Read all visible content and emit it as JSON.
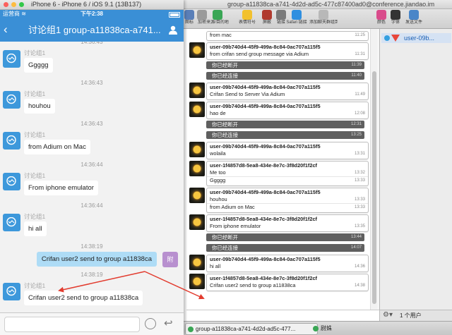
{
  "simulator": {
    "window_title": "iPhone 6 - iPhone 6 / iOS 9.1 (13B137)",
    "status": {
      "carrier": "运营商",
      "time": "下午2:38"
    },
    "nav_title": "讨论组1 group-a11838ca-a741...",
    "messages": [
      {
        "kind": "received",
        "time": "14:36:43",
        "sender": "讨论组1",
        "text": "Ggggg"
      },
      {
        "kind": "received",
        "time": "14:36:43",
        "sender": "讨论组1",
        "text": "houhou"
      },
      {
        "kind": "received",
        "time": "14:36:43",
        "sender": "讨论组1",
        "text": "from Adium on Mac"
      },
      {
        "kind": "received",
        "time": "14:36:44",
        "sender": "讨论组1",
        "text": "From iphone emulator"
      },
      {
        "kind": "received",
        "time": "14:36:44",
        "sender": "讨论组1",
        "text": "hi all"
      },
      {
        "kind": "sent",
        "time": "14:38:19",
        "text": "Crifan user2 send to group a11838ca",
        "avatar_label": "附"
      },
      {
        "kind": "received",
        "time": "14:38:19",
        "sender": "讨论组1",
        "text": "Crifan user2 send to group a11838ca"
      }
    ]
  },
  "adium": {
    "window_title": "group-a11838ca-a741-4d2d-ad5c-477c87400ad0@conference.jiandao.im",
    "toolbar": [
      {
        "label": "图标",
        "icon": "format-icon",
        "color": "#5a7fb8"
      },
      {
        "label": "加密",
        "icon": "lock-icon",
        "color": "#9a9a9a"
      },
      {
        "label": "来源/目的地",
        "icon": "source-icon",
        "color": "#3aa655"
      },
      {
        "label": "表情符号",
        "icon": "smiley-icon",
        "color": "#f2c12e"
      },
      {
        "label": "屏蔽",
        "icon": "block-icon",
        "color": "#b03a2e"
      },
      {
        "label": "链接",
        "icon": "link-icon",
        "color": "#7a7a7a"
      },
      {
        "label": "Safari 链接",
        "icon": "safari-icon",
        "color": "#2f8fe0"
      },
      {
        "label": "添加聊天群组到收藏",
        "icon": "bookmark-icon",
        "color": "#b8b8b8"
      },
      {
        "label": "颜色",
        "icon": "color-icon",
        "color": "#d94b8b"
      },
      {
        "label": "字体",
        "icon": "font-icon",
        "color": "#333333"
      },
      {
        "label": "发送文件",
        "icon": "send-file-icon",
        "color": "#4a86c8"
      }
    ],
    "messages": [
      {
        "type": "bubble",
        "header": "",
        "lines": [
          {
            "text": "from mac",
            "time": "11:25"
          }
        ]
      },
      {
        "type": "bubble",
        "header": "user-09b740d4-45f9-499a-8c84-0ac707a115f5",
        "lines": [
          {
            "text": "from crifan send group message via Adium",
            "time": "11:31"
          }
        ]
      },
      {
        "type": "status",
        "text": "你已经断开",
        "time": "11:39"
      },
      {
        "type": "status",
        "text": "你已经连接",
        "time": "11:40"
      },
      {
        "type": "bubble",
        "header": "user-09b740d4-45f9-499a-8c84-0ac707a115f5",
        "lines": [
          {
            "text": "Crifan Send to Server Via Adium",
            "time": "11:49"
          }
        ]
      },
      {
        "type": "bubble",
        "header": "user-09b740d4-45f9-499a-8c84-0ac707a115f5",
        "lines": [
          {
            "text": "hao de",
            "time": "12:08"
          }
        ]
      },
      {
        "type": "status",
        "text": "你已经断开",
        "time": "12:31"
      },
      {
        "type": "status",
        "text": "你已经连接",
        "time": "13:25"
      },
      {
        "type": "bubble",
        "header": "user-09b740d4-45f9-499a-8c84-0ac707a115f5",
        "lines": [
          {
            "text": "wolaila",
            "time": "13:31"
          }
        ]
      },
      {
        "type": "bubble",
        "header": "user-1f4857d8-5ea8-434e-8e7c-3f8d20f1f2cf",
        "lines": [
          {
            "text": "Me too",
            "time": "13:32"
          },
          {
            "text": "Ggggg",
            "time": "13:33"
          }
        ]
      },
      {
        "type": "bubble",
        "header": "user-09b740d4-45f9-499a-8c84-0ac707a115f5",
        "lines": [
          {
            "text": "houhou",
            "time": "13:33"
          },
          {
            "text": "from Adium on Mac",
            "time": "13:33"
          }
        ]
      },
      {
        "type": "bubble",
        "header": "user-1f4857d8-5ea8-434e-8e7c-3f8d20f1f2cf",
        "lines": [
          {
            "text": "From iphone emulator",
            "time": "13:35"
          }
        ]
      },
      {
        "type": "status",
        "text": "你已经断开",
        "time": "13:44"
      },
      {
        "type": "status",
        "text": "你已经连接",
        "time": "14:07"
      },
      {
        "type": "bubble",
        "header": "user-09b740d4-45f9-499a-8c84-0ac707a115f5",
        "lines": [
          {
            "text": "hi all",
            "time": "14:36"
          }
        ]
      },
      {
        "type": "bubble",
        "header": "user-1f4857d8-5ea8-434e-8e7c-3f8d20f1f2cf",
        "lines": [
          {
            "text": "Crifan user2 send to group a11838ca",
            "time": "14:38"
          }
        ]
      }
    ],
    "participant": "user-09b...",
    "user_count": "1 个用户",
    "tabs": [
      {
        "label": "group-a11838ca-a741-4d2d-ad5c-477...",
        "color": "#3aa655"
      },
      {
        "label": "尉姝",
        "color": "#3aa655"
      }
    ]
  },
  "colors": {
    "ios_accent": "#3a8fd6",
    "arrow": "#e23b2e"
  }
}
